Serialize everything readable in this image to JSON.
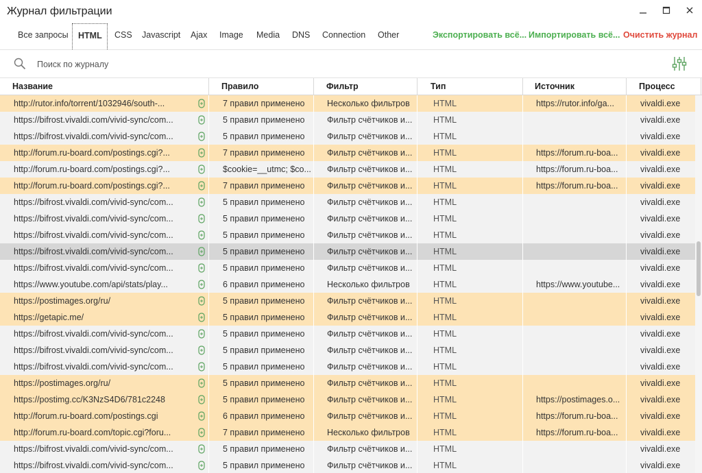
{
  "window": {
    "title": "Журнал фильтрации"
  },
  "tabs": [
    {
      "label": "Все запросы"
    },
    {
      "label": "HTML"
    },
    {
      "label": "CSS"
    },
    {
      "label": "Javascript"
    },
    {
      "label": "Ajax"
    },
    {
      "label": "Image"
    },
    {
      "label": "Media"
    },
    {
      "label": "DNS"
    },
    {
      "label": "Connection"
    },
    {
      "label": "Other"
    }
  ],
  "active_tab": "HTML",
  "actions": {
    "export": "Экспортировать всё...",
    "import": "Импортировать всё...",
    "clear": "Очистить журнал"
  },
  "search": {
    "placeholder": "Поиск по журналу",
    "value": ""
  },
  "columns": [
    "Название",
    "Правило",
    "Фильтр",
    "Тип",
    "Источник",
    "Процесс"
  ],
  "colors": {
    "highlight": "#fde3b5",
    "normal": "#f2f2f2",
    "selected": "#d6d6d6",
    "accent_green": "#4caf50",
    "accent_red": "#e04a3d"
  },
  "rows": [
    {
      "style": "highlight",
      "name": "http://rutor.info/torrent/1032946/south-...",
      "rule": "7 правил применено",
      "filter": "Несколько фильтров",
      "type": "HTML",
      "source": "https://rutor.info/ga...",
      "process": "vivaldi.exe"
    },
    {
      "style": "normal",
      "name": "https://bifrost.vivaldi.com/vivid-sync/com...",
      "rule": "5 правил применено",
      "filter": "Фильтр счётчиков и...",
      "type": "HTML",
      "source": "",
      "process": "vivaldi.exe"
    },
    {
      "style": "normal",
      "name": "https://bifrost.vivaldi.com/vivid-sync/com...",
      "rule": "5 правил применено",
      "filter": "Фильтр счётчиков и...",
      "type": "HTML",
      "source": "",
      "process": "vivaldi.exe"
    },
    {
      "style": "highlight",
      "name": "http://forum.ru-board.com/postings.cgi?...",
      "rule": "7 правил применено",
      "filter": "Фильтр счётчиков и...",
      "type": "HTML",
      "source": "https://forum.ru-boa...",
      "process": "vivaldi.exe"
    },
    {
      "style": "normal",
      "name": "http://forum.ru-board.com/postings.cgi?...",
      "rule": "$cookie=__utmc; $co...",
      "filter": "Фильтр счётчиков и...",
      "type": "HTML",
      "source": "https://forum.ru-boa...",
      "process": "vivaldi.exe"
    },
    {
      "style": "highlight",
      "name": "http://forum.ru-board.com/postings.cgi?...",
      "rule": "7 правил применено",
      "filter": "Фильтр счётчиков и...",
      "type": "HTML",
      "source": "https://forum.ru-boa...",
      "process": "vivaldi.exe"
    },
    {
      "style": "normal",
      "name": "https://bifrost.vivaldi.com/vivid-sync/com...",
      "rule": "5 правил применено",
      "filter": "Фильтр счётчиков и...",
      "type": "HTML",
      "source": "",
      "process": "vivaldi.exe"
    },
    {
      "style": "normal",
      "name": "https://bifrost.vivaldi.com/vivid-sync/com...",
      "rule": "5 правил применено",
      "filter": "Фильтр счётчиков и...",
      "type": "HTML",
      "source": "",
      "process": "vivaldi.exe"
    },
    {
      "style": "normal",
      "name": "https://bifrost.vivaldi.com/vivid-sync/com...",
      "rule": "5 правил применено",
      "filter": "Фильтр счётчиков и...",
      "type": "HTML",
      "source": "",
      "process": "vivaldi.exe"
    },
    {
      "style": "selected",
      "name": "https://bifrost.vivaldi.com/vivid-sync/com...",
      "rule": "5 правил применено",
      "filter": "Фильтр счётчиков и...",
      "type": "HTML",
      "source": "",
      "process": "vivaldi.exe"
    },
    {
      "style": "normal",
      "name": "https://bifrost.vivaldi.com/vivid-sync/com...",
      "rule": "5 правил применено",
      "filter": "Фильтр счётчиков и...",
      "type": "HTML",
      "source": "",
      "process": "vivaldi.exe"
    },
    {
      "style": "normal",
      "name": "https://www.youtube.com/api/stats/play...",
      "rule": "6 правил применено",
      "filter": "Несколько фильтров",
      "type": "HTML",
      "source": "https://www.youtube...",
      "process": "vivaldi.exe"
    },
    {
      "style": "highlight",
      "name": "https://postimages.org/ru/",
      "rule": "5 правил применено",
      "filter": "Фильтр счётчиков и...",
      "type": "HTML",
      "source": "",
      "process": "vivaldi.exe"
    },
    {
      "style": "highlight",
      "name": "https://getapic.me/",
      "rule": "5 правил применено",
      "filter": "Фильтр счётчиков и...",
      "type": "HTML",
      "source": "",
      "process": "vivaldi.exe"
    },
    {
      "style": "normal",
      "name": "https://bifrost.vivaldi.com/vivid-sync/com...",
      "rule": "5 правил применено",
      "filter": "Фильтр счётчиков и...",
      "type": "HTML",
      "source": "",
      "process": "vivaldi.exe"
    },
    {
      "style": "normal",
      "name": "https://bifrost.vivaldi.com/vivid-sync/com...",
      "rule": "5 правил применено",
      "filter": "Фильтр счётчиков и...",
      "type": "HTML",
      "source": "",
      "process": "vivaldi.exe"
    },
    {
      "style": "normal",
      "name": "https://bifrost.vivaldi.com/vivid-sync/com...",
      "rule": "5 правил применено",
      "filter": "Фильтр счётчиков и...",
      "type": "HTML",
      "source": "",
      "process": "vivaldi.exe"
    },
    {
      "style": "highlight",
      "name": "https://postimages.org/ru/",
      "rule": "5 правил применено",
      "filter": "Фильтр счётчиков и...",
      "type": "HTML",
      "source": "",
      "process": "vivaldi.exe"
    },
    {
      "style": "highlight",
      "name": "https://postimg.cc/K3NzS4D6/781c2248",
      "rule": "5 правил применено",
      "filter": "Фильтр счётчиков и...",
      "type": "HTML",
      "source": "https://postimages.o...",
      "process": "vivaldi.exe"
    },
    {
      "style": "highlight",
      "name": "http://forum.ru-board.com/postings.cgi",
      "rule": "6 правил применено",
      "filter": "Фильтр счётчиков и...",
      "type": "HTML",
      "source": "https://forum.ru-boa...",
      "process": "vivaldi.exe"
    },
    {
      "style": "highlight",
      "name": "http://forum.ru-board.com/topic.cgi?foru...",
      "rule": "7 правил применено",
      "filter": "Несколько фильтров",
      "type": "HTML",
      "source": "https://forum.ru-boa...",
      "process": "vivaldi.exe"
    },
    {
      "style": "normal",
      "name": "https://bifrost.vivaldi.com/vivid-sync/com...",
      "rule": "5 правил применено",
      "filter": "Фильтр счётчиков и...",
      "type": "HTML",
      "source": "",
      "process": "vivaldi.exe"
    },
    {
      "style": "normal",
      "name": "https://bifrost.vivaldi.com/vivid-sync/com...",
      "rule": "5 правил применено",
      "filter": "Фильтр счётчиков и...",
      "type": "HTML",
      "source": "",
      "process": "vivaldi.exe"
    }
  ]
}
